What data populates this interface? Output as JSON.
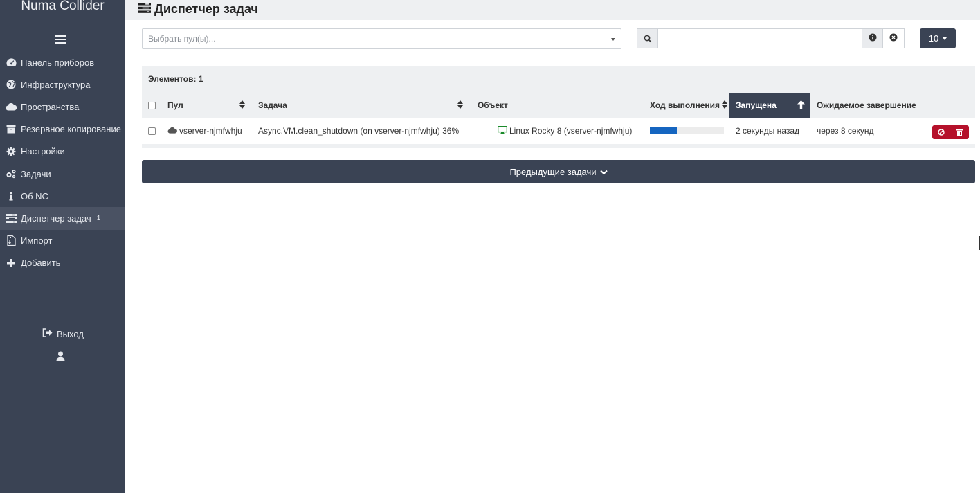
{
  "app": {
    "name": "Numa Collider"
  },
  "sidebar": {
    "items": [
      {
        "label": "Панель приборов",
        "icon": "dashboard-icon"
      },
      {
        "label": "Инфраструктура",
        "icon": "globe-icon"
      },
      {
        "label": "Пространства",
        "icon": "cloud-icon"
      },
      {
        "label": "Резервное копирование",
        "icon": "archive-icon"
      },
      {
        "label": "Настройки",
        "icon": "gear-icon"
      },
      {
        "label": "Задачи",
        "icon": "gears-icon"
      },
      {
        "label": "Об NC",
        "icon": "info-icon"
      },
      {
        "label": "Диспетчер задач",
        "icon": "tasks-icon",
        "badge": "1",
        "active": true
      },
      {
        "label": "Импорт",
        "icon": "import-icon"
      },
      {
        "label": "Добавить",
        "icon": "plus-icon"
      }
    ],
    "logout_label": "Выход"
  },
  "header": {
    "title": "Диспетчер задач"
  },
  "filters": {
    "pool_placeholder": "Выбрать пул(ы)...",
    "search_value": "",
    "page_size": "10"
  },
  "table": {
    "count_label": "Элементов: 1",
    "columns": {
      "pool": "Пул",
      "task": "Задача",
      "object": "Объект",
      "progress": "Ход выполнения",
      "started": "Запущена",
      "eta": "Ожидаемое завершение"
    },
    "rows": [
      {
        "pool": "vserver-njmfwhju",
        "task": "Async.VM.clean_shutdown (on vserver-njmfwhju) 36%",
        "object": "Linux Rocky 8 (vserver-njmfwhju)",
        "progress": 36,
        "started": "2 секунды назад",
        "eta": "через 8 секунд"
      }
    ]
  },
  "prev_tasks_label": "Предыдущие задачи",
  "colors": {
    "sidebar_bg": "#3a4354",
    "accent": "#3a4354",
    "progress": "#1565c0",
    "danger": "#b5112b"
  }
}
